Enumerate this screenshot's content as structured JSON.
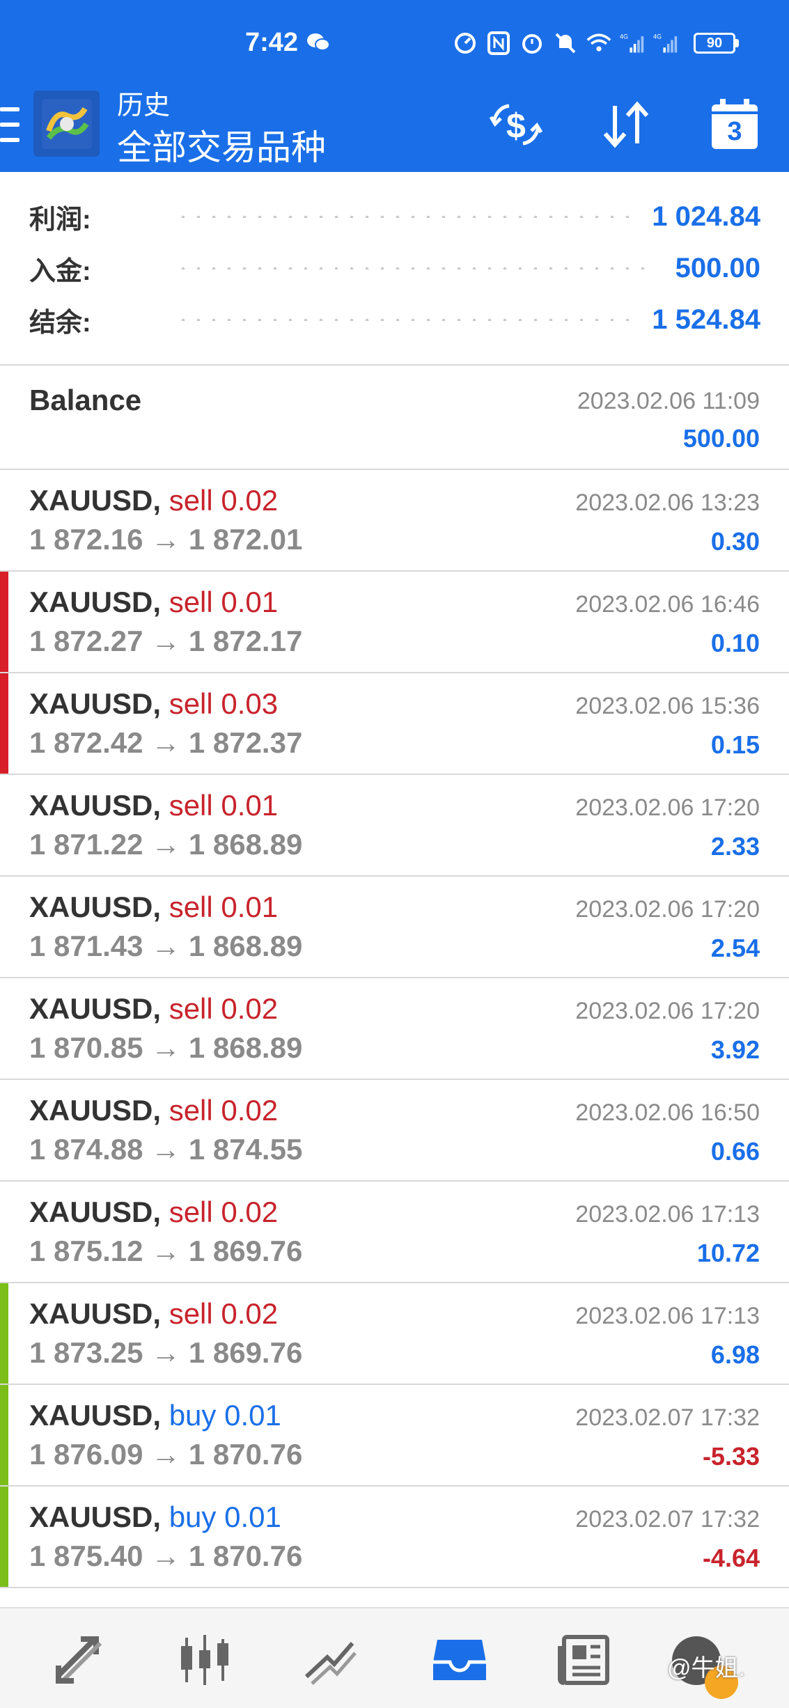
{
  "status_bar": {
    "time": "7:42",
    "battery": "90",
    "icons": [
      "wechat-icon",
      "speed-icon",
      "nfc-icon",
      "alarm-icon",
      "mute-icon",
      "wifi-icon",
      "signal-4g-icon",
      "signal-4g-icon"
    ]
  },
  "header": {
    "title_small": "历史",
    "title_big": "全部交易品种",
    "calendar_day": "3",
    "icons": [
      "menu-icon",
      "metatrader-logo",
      "currency-exchange-icon",
      "sort-icon",
      "calendar-icon"
    ]
  },
  "summary": {
    "profit_label": "利润:",
    "profit_value": "1 024.84",
    "deposit_label": "入金:",
    "deposit_value": "500.00",
    "balance_label": "结余:",
    "balance_value": "1 524.84"
  },
  "balance_entry": {
    "title": "Balance",
    "date": "2023.02.06 11:09",
    "value": "500.00"
  },
  "deals": [
    {
      "symbol": "XAUUSD,",
      "type": "sell",
      "type_text": "sell 0.02",
      "prices": "1 872.16 → 1 872.01",
      "date": "2023.02.06 13:23",
      "profit": "0.30",
      "marker": "none"
    },
    {
      "symbol": "XAUUSD,",
      "type": "sell",
      "type_text": "sell 0.01",
      "prices": "1 872.27 → 1 872.17",
      "date": "2023.02.06 16:46",
      "profit": "0.10",
      "marker": "red"
    },
    {
      "symbol": "XAUUSD,",
      "type": "sell",
      "type_text": "sell 0.03",
      "prices": "1 872.42 → 1 872.37",
      "date": "2023.02.06 15:36",
      "profit": "0.15",
      "marker": "red"
    },
    {
      "symbol": "XAUUSD,",
      "type": "sell",
      "type_text": "sell 0.01",
      "prices": "1 871.22 → 1 868.89",
      "date": "2023.02.06 17:20",
      "profit": "2.33",
      "marker": "none"
    },
    {
      "symbol": "XAUUSD,",
      "type": "sell",
      "type_text": "sell 0.01",
      "prices": "1 871.43 → 1 868.89",
      "date": "2023.02.06 17:20",
      "profit": "2.54",
      "marker": "none"
    },
    {
      "symbol": "XAUUSD,",
      "type": "sell",
      "type_text": "sell 0.02",
      "prices": "1 870.85 → 1 868.89",
      "date": "2023.02.06 17:20",
      "profit": "3.92",
      "marker": "none"
    },
    {
      "symbol": "XAUUSD,",
      "type": "sell",
      "type_text": "sell 0.02",
      "prices": "1 874.88 → 1 874.55",
      "date": "2023.02.06 16:50",
      "profit": "0.66",
      "marker": "none"
    },
    {
      "symbol": "XAUUSD,",
      "type": "sell",
      "type_text": "sell 0.02",
      "prices": "1 875.12 → 1 869.76",
      "date": "2023.02.06 17:13",
      "profit": "10.72",
      "marker": "none"
    },
    {
      "symbol": "XAUUSD,",
      "type": "sell",
      "type_text": "sell 0.02",
      "prices": "1 873.25 → 1 869.76",
      "date": "2023.02.06 17:13",
      "profit": "6.98",
      "marker": "green"
    },
    {
      "symbol": "XAUUSD,",
      "type": "buy",
      "type_text": "buy 0.01",
      "prices": "1 876.09 → 1 870.76",
      "date": "2023.02.07 17:32",
      "profit": "-5.33",
      "marker": "green"
    },
    {
      "symbol": "XAUUSD,",
      "type": "buy",
      "type_text": "buy 0.01",
      "prices": "1 875.40 → 1 870.76",
      "date": "2023.02.07 17:32",
      "profit": "-4.64",
      "marker": "green"
    }
  ],
  "bottom_nav": {
    "items": [
      "quotes-icon",
      "chart-candles-icon",
      "trade-icon",
      "history-inbox-icon",
      "news-icon",
      "user-icon"
    ],
    "active": "history-inbox-icon",
    "watermark": "@牛姐."
  },
  "colors": {
    "accent": "#1a6fe8",
    "sell": "#c8232c",
    "marker_red": "#d81e28",
    "marker_green": "#7bbe1a"
  }
}
